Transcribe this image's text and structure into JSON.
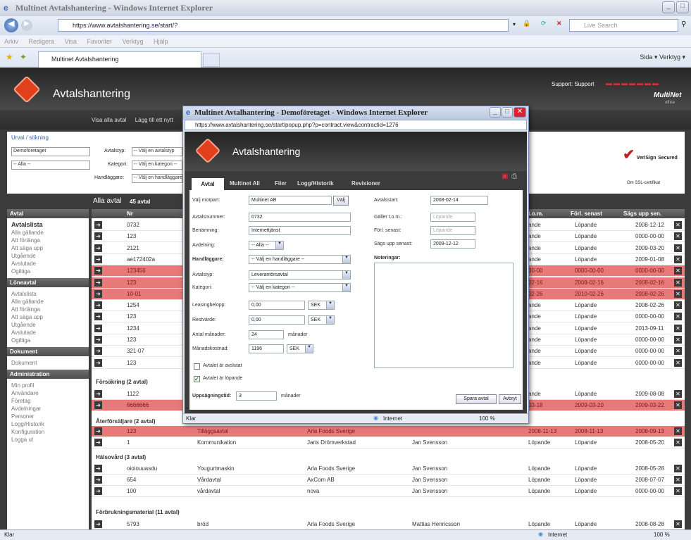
{
  "browser": {
    "title": "Multinet Avtalshantering - Windows Internet Explorer",
    "url": "https://www.avtalshantering.se/start/?",
    "search_placeholder": "Live Search",
    "menu": [
      "Arkiv",
      "Redigera",
      "Visa",
      "Favoriter",
      "Verktyg",
      "Hjälp"
    ],
    "tab_label": "Multinet Avtalshantering",
    "tools": "Sida ▾  Verktyg ▾",
    "status": "Klar",
    "zone": "Internet",
    "zoom": "100 %"
  },
  "app": {
    "brand": "Avtalshantering",
    "support": "Support: Support",
    "multinet": "MultiNet",
    "office": "office",
    "nav": [
      "Visa alla avtal",
      "Lägg till ett nytt"
    ],
    "filter": {
      "title": "Urval / sökning",
      "company": "Demoföretaget",
      "all": "-- Alla --",
      "type_label": "Avtalstyp:",
      "type_val": "-- Välj en avtalstyp",
      "cat_label": "Kategori:",
      "cat_val": "-- Välj en kategori --",
      "handler_label": "Handläggare:",
      "handler_val": "-- Välj en handläggare"
    },
    "verisign": {
      "t1": "VeriSign",
      "t2": "Secured",
      "sub": "Om SSL-certifikat"
    },
    "list_title": "Alla avtal",
    "list_count": "45 avtal",
    "cols": {
      "nr": "Nr",
      "tom": "t.o.m.",
      "forl": "Förl. senast",
      "sags": "Sägs upp sen."
    }
  },
  "sidebar": [
    {
      "h": "Avtal",
      "items": [
        "Avtalslista",
        "Alla gällande",
        "Att förlänga",
        "Att säga upp",
        "Utgående",
        "Avslutade",
        "Ogiltiga"
      ]
    },
    {
      "h": "Löneavtal",
      "items": [
        "Avtalslista",
        "Alla gällande",
        "Att förlänga",
        "Att säga upp",
        "Utgående",
        "Avslutade",
        "Ogiltiga"
      ]
    },
    {
      "h": "Dokument",
      "items": [
        "Dokument"
      ]
    },
    {
      "h": "Administration",
      "items": [
        "Min profil",
        "Användare",
        "Företag",
        "Avdelningar",
        "Personer",
        "Logg/Historik",
        "Konfiguration",
        "Logga ut"
      ]
    }
  ],
  "rows": [
    {
      "nr": "0732",
      "a": "ande",
      "b": "Löpande",
      "c": "2008-12-12",
      "red": false
    },
    {
      "nr": "123",
      "a": "ande",
      "b": "Löpande",
      "c": "0000-00-00",
      "red": false
    },
    {
      "nr": "2121",
      "a": "ande",
      "b": "Löpande",
      "c": "2009-03-20",
      "red": false
    },
    {
      "nr": "ae172402a",
      "a": "ande",
      "b": "Löpande",
      "c": "2009-01-08",
      "red": false
    },
    {
      "nr": "123456",
      "a": "00-00",
      "b": "0000-00-00",
      "c": "0000-00-00",
      "red": true
    },
    {
      "nr": "123",
      "a": "02-16",
      "b": "2008-02-16",
      "c": "2008-02-16",
      "red": true
    },
    {
      "nr": "10-01",
      "a": "02-26",
      "b": "2010-02-26",
      "c": "2008-02-26",
      "red": true
    },
    {
      "nr": "1254",
      "a": "ande",
      "b": "Löpande",
      "c": "2008-02-26",
      "red": false
    },
    {
      "nr": "123",
      "a": "ande",
      "b": "Löpande",
      "c": "0000-00-00",
      "red": false
    },
    {
      "nr": "1234",
      "a": "ande",
      "b": "Löpande",
      "c": "2013-09-11",
      "red": false
    },
    {
      "nr": "123",
      "a": "ande",
      "b": "Löpande",
      "c": "0000-00-00",
      "red": false
    },
    {
      "nr": "321-07",
      "a": "ande",
      "b": "Löpande",
      "c": "0000-00-00",
      "red": false
    },
    {
      "nr": "123",
      "a": "ande",
      "b": "Löpande",
      "c": "0000-00-00",
      "red": false
    }
  ],
  "groups": [
    {
      "label": "Försäkring (2 avtal)",
      "rows": [
        {
          "nr": "1122",
          "name": "",
          "party": "",
          "person": "",
          "a": "ande",
          "b": "Löpande",
          "c": "2009-08-08",
          "red": false
        },
        {
          "nr": "6666666",
          "name": "",
          "party": "",
          "person": "",
          "a": "03-18",
          "b": "2009-03-20",
          "c": "2009-03-22",
          "red": true
        }
      ]
    },
    {
      "label": "Återförsäljare (2 avtal)",
      "rows": [
        {
          "nr": "123",
          "name": "Tilläggsavtal",
          "party": "Arla Foods Sverige",
          "person": "",
          "a": "2008-11-13",
          "b": "2008-11-13",
          "c": "2008-09-13",
          "red": true
        },
        {
          "nr": "1",
          "name": "Kommunikation",
          "party": "Jaris Drömverkstad",
          "person": "Jan Svensson",
          "a": "Löpande",
          "b": "Löpande",
          "c": "2008-05-20",
          "red": false
        }
      ]
    },
    {
      "label": "Hälsovård (3 avtal)",
      "rows": [
        {
          "nr": "oioiouuasdu",
          "name": "Yougurtmaskin",
          "party": "Arla Foods Sverige",
          "person": "Jan Svensson",
          "a": "Löpande",
          "b": "Löpande",
          "c": "2008-05-28",
          "red": false
        },
        {
          "nr": "654",
          "name": "Vårdavtal",
          "party": "AxCom AB",
          "person": "Jan Svensson",
          "a": "Löpande",
          "b": "Löpande",
          "c": "2008-07-07",
          "red": false
        },
        {
          "nr": "100",
          "name": "vårdavtal",
          "party": "nova",
          "person": "Jan Svensson",
          "a": "Löpande",
          "b": "Löpande",
          "c": "0000-00-00",
          "red": false
        }
      ]
    },
    {
      "label": "Förbrukningsmaterial (11 avtal)",
      "rows": [
        {
          "nr": "5793",
          "name": "bröd",
          "party": "Arla Foods Sverige",
          "person": "Mattias Henricsson",
          "a": "Löpande",
          "b": "Löpande",
          "c": "2008-08-28",
          "red": false
        }
      ]
    }
  ],
  "popup": {
    "title": "Multinet Avtalhantering - Demoföretaget - Windows Internet Explorer",
    "url": "https://www.avtalshantering.se/start/popup.php?p=contract.view&contractid=1276",
    "tabs": [
      "Avtal",
      "Multinet All",
      "Filer",
      "Logg/Historik",
      "Revisioner"
    ],
    "f": {
      "motpart_l": "Välj motpart:",
      "motpart": "Multinet AB",
      "valj": "Välj",
      "avtnr_l": "Avtalsnummer:",
      "avtnr": "0732",
      "ben_l": "Benämning:",
      "ben": "Internettjänst",
      "avd_l": "Avdelning:",
      "avd": "-- Alla --",
      "hand_l": "Handläggare:",
      "hand": "-- Välj en handläggare --",
      "typ_l": "Avtalstyp:",
      "typ": "Leverantörsavtal",
      "kat_l": "Kategori:",
      "kat": "-- Välj en kategori --",
      "leas_l": "Leasingbelopp:",
      "leas": "0,00",
      "rest_l": "Restvärde:",
      "rest": "0,00",
      "sek": "SEK",
      "antal_l": "Antal månader:",
      "antal": "24",
      "manader": "månader",
      "mkost_l": "Månadskostnad:",
      "mkost": "1196",
      "chk1": "Avtalet är avslutat",
      "chk2": "Avtalet är löpande",
      "upps_l": "Uppsägningstid:",
      "upps": "3",
      "start_l": "Avtalsstart:",
      "start": "2008-02-14",
      "galler_l": "Gäller t.o.m.:",
      "galler": "Löpande",
      "forl_l": "Förl. senast:",
      "forl": "Löpande",
      "sags_l": "Sägs upp senast:",
      "sags": "2009-12-12",
      "not_l": "Noteringar:",
      "spara": "Spara avtal",
      "avbryt": "Avbryt"
    },
    "status": "Klar",
    "zone": "Internet",
    "zoom": "100 %"
  }
}
